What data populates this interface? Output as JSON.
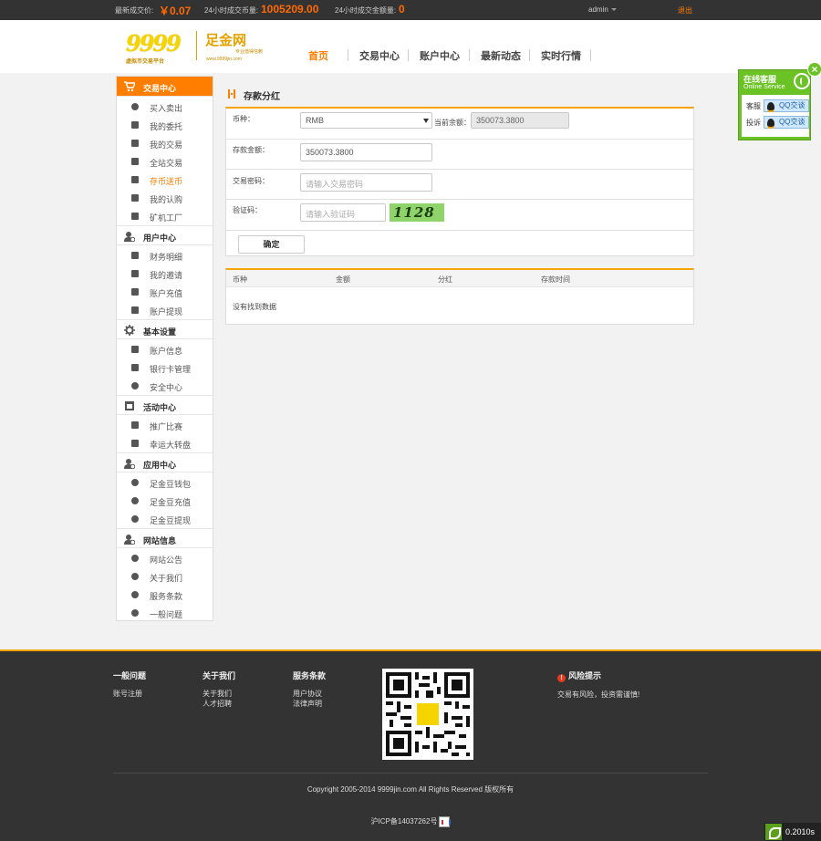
{
  "topbar": {
    "last_price_label": "最新成交价:",
    "last_price_value": "￥0.07",
    "vol24_label": "24小时成交币量:",
    "vol24_value": "1005209.00",
    "amt24_label": "24小时成交金额量:",
    "amt24_value": "0",
    "user": "admin",
    "logout": "退出"
  },
  "logo": {
    "number": "9999",
    "brand": "足金网",
    "tagline": "虚拟币交易平台",
    "slogan": "专业值得信赖",
    "domain": "www.9999jin.com"
  },
  "nav": [
    "首页",
    "交易中心",
    "账户中心",
    "最新动态",
    "实时行情"
  ],
  "sidebar": {
    "groups": [
      {
        "title": "交易中心",
        "items": [
          "买入卖出",
          "我的委托",
          "我的交易",
          "全站交易",
          "存币送币",
          "我的认购",
          "矿机工厂"
        ]
      },
      {
        "title": "用户中心",
        "items": [
          "财务明细",
          "我的邀请",
          "账户充值",
          "账户提现"
        ]
      },
      {
        "title": "基本设置",
        "items": [
          "账户信息",
          "银行卡管理",
          "安全中心"
        ]
      },
      {
        "title": "活动中心",
        "items": [
          "推广比赛",
          "幸运大转盘"
        ]
      },
      {
        "title": "应用中心",
        "items": [
          "足金豆钱包",
          "足金豆充值",
          "足金豆提现"
        ]
      },
      {
        "title": "网站信息",
        "items": [
          "网站公告",
          "关于我们",
          "服务条款",
          "一般问题"
        ]
      }
    ]
  },
  "main": {
    "title": "存款分红",
    "currency_label": "币种：",
    "currency_value": "RMB",
    "balance_label": "当前余额：",
    "balance_value": "350073.3800",
    "amount_label": "存款金额：",
    "amount_value": "350073.3800",
    "password_label": "交易密码：",
    "password_placeholder": "请输入交易密码",
    "captcha_label": "验证码：",
    "captcha_placeholder": "请输入验证码",
    "captcha_text": "1128",
    "submit": "确定"
  },
  "table": {
    "headers": [
      "币种",
      "金额",
      "分红",
      "存款时间"
    ],
    "empty": "没有找到数据"
  },
  "service": {
    "title": "在线客服",
    "subtitle": "Online Service",
    "row1_label": "客服",
    "row1_btn": "QQ交谈",
    "row2_label": "投诉",
    "row2_btn": "QQ交谈",
    "close": "×"
  },
  "footer": {
    "col1": {
      "title": "一般问题",
      "links": [
        "账号注册"
      ]
    },
    "col2": {
      "title": "关于我们",
      "links": [
        "关于我们",
        "人才招聘"
      ]
    },
    "col3": {
      "title": "服务条款",
      "links": [
        "用户协议",
        "法律声明"
      ]
    },
    "risk": {
      "title": "风险提示",
      "text": "交易有风险，投资需谨慎!"
    },
    "copyright": "Copyright 2005-2014 9999jin.com All Rights Reserved 版权所有",
    "icp": "沪ICP备14037262号"
  },
  "timer": "0.2010s",
  "colors": {
    "accent": "#ff7e00",
    "service_green": "#6bc224",
    "footer_bg": "#333333"
  }
}
